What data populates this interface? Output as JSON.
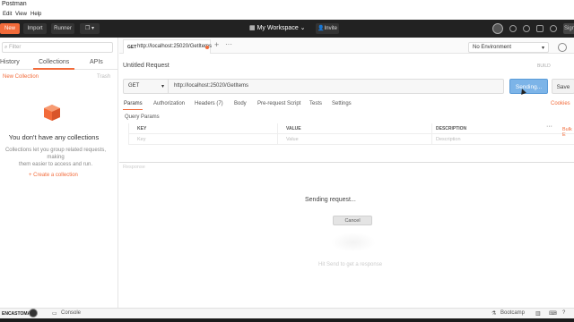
{
  "window": {
    "title": "Postman"
  },
  "menu": {
    "items": [
      "Edit",
      "View",
      "Help"
    ]
  },
  "toolbar": {
    "new_label": "New",
    "import_label": "Import",
    "runner_label": "Runner",
    "workspace_label": "My Workspace",
    "invite_label": "Invite",
    "signin_label": "Sign"
  },
  "sidebar": {
    "filter_placeholder": "Filter",
    "tabs": [
      "History",
      "Collections",
      "APIs"
    ],
    "new_collection": "New Collection",
    "trash": "Trash",
    "empty_title": "You don't have any collections",
    "empty_sub_1": "Collections let you group related requests, making",
    "empty_sub_2": "them easier to access and run.",
    "create_collection": "+ Create a collection"
  },
  "tab": {
    "method": "GET",
    "url": "http://localhost:25020/GetItems"
  },
  "environment": {
    "selected": "No Environment"
  },
  "request": {
    "title": "Untitled Request",
    "build": "BUILD",
    "method": "GET",
    "url": "http://localhost:25020/GetItems",
    "send_label": "Sending...",
    "save_label": "Save",
    "tabs": [
      "Params",
      "Authorization",
      "Headers (7)",
      "Body",
      "Pre-request Script",
      "Tests",
      "Settings"
    ],
    "cookies": "Cookies",
    "query_params_label": "Query Params",
    "columns": [
      "KEY",
      "VALUE",
      "DESCRIPTION"
    ],
    "placeholders": [
      "Key",
      "Value",
      "Description"
    ],
    "bulk_edit": "Bulk E"
  },
  "response": {
    "label": "Response",
    "sending": "Sending request...",
    "cancel": "Cancel",
    "hint": "Hit Send to get a response"
  },
  "statusbar": {
    "left_text": "Console",
    "bootcamp": "Bootcamp",
    "watermark": "ENCASTOMATIC"
  }
}
